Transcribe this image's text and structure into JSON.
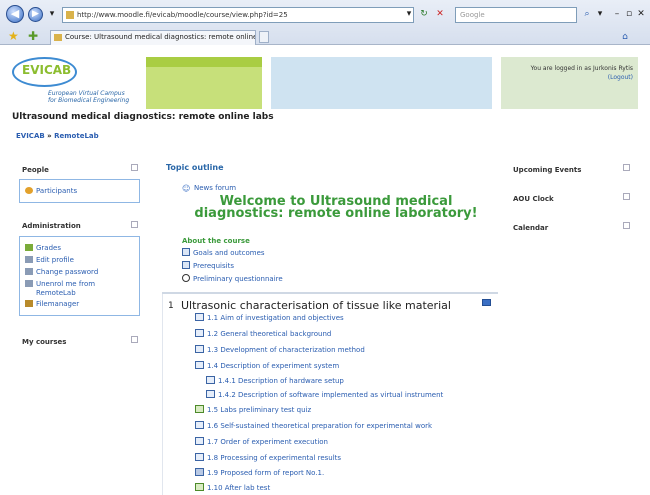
{
  "browser": {
    "url": "http://www.moodle.fi/evicab/moodle/course/view.php?id=25",
    "search_placeholder": "Google",
    "tab_title": "Course: Ultrasound medical diagnostics: remote online..."
  },
  "header": {
    "logo_name": "EVICAB",
    "logo_subtitle_1": "European Virtual Campus",
    "logo_subtitle_2": "for Biomedical Engineering",
    "login_prefix": "You are logged in as Jurkonis Rytis",
    "logout": "(Logout)"
  },
  "course": {
    "title": "Ultrasound medical diagnostics: remote online labs",
    "breadcrumb_root": "EVICAB",
    "breadcrumb_sep": "»",
    "breadcrumb_current": "RemoteLab"
  },
  "left": {
    "people": {
      "title": "People",
      "items": [
        "Participants"
      ]
    },
    "administration": {
      "title": "Administration",
      "items": [
        "Grades",
        "Edit profile",
        "Change password",
        "Unenrol me from",
        "RemoteLab",
        "Filemanager"
      ]
    },
    "my_courses": {
      "title": "My courses"
    }
  },
  "main": {
    "topic_outline": "Topic outline",
    "news_forum": "News forum",
    "welcome_line1": "Welcome to Ultrasound medical",
    "welcome_line2": "diagnostics: remote online laboratory!",
    "about_title": "About the course",
    "about_items": [
      "Goals and outcomes",
      "Prerequisits",
      "Preliminary questionnaire"
    ],
    "section_number": "1",
    "section_title": "Ultrasonic characterisation of tissue like material",
    "resources": [
      "1.1 Aim of investigation and objectives",
      "1.2 General theoretical background",
      "1.3 Development of characterization method",
      "1.4 Description of experiment system",
      "1.4.1 Description of hardware setup",
      "1.4.2 Description of software implemented as virtual instrument",
      "1.5 Labs preliminary test quiz",
      "1.6 Self-sustained theoretical preparation for experimental work",
      "1.7 Order of experiment execution",
      "1.8 Processing of experimental results",
      "1.9 Proposed form of report No.1.",
      "1.10 After lab test"
    ]
  },
  "right": {
    "upcoming_events": "Upcoming Events",
    "aou_clock": "AOU Clock",
    "calendar": "Calendar"
  }
}
